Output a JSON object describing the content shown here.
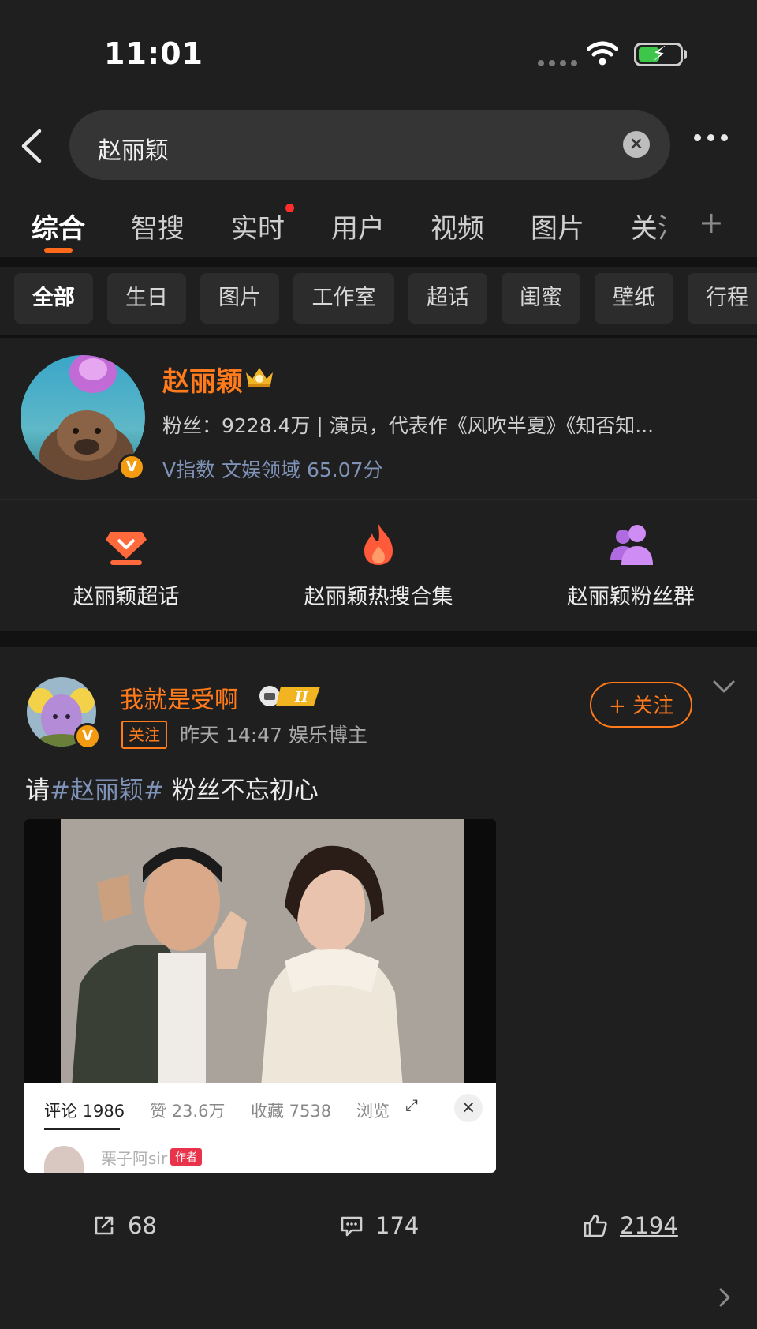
{
  "status_bar": {
    "time": "11:01"
  },
  "search": {
    "query": "赵丽颖"
  },
  "tabs": [
    {
      "label": "综合",
      "active": true
    },
    {
      "label": "智搜"
    },
    {
      "label": "实时",
      "has_dot": true
    },
    {
      "label": "用户"
    },
    {
      "label": "视频"
    },
    {
      "label": "图片"
    },
    {
      "label": "关注"
    }
  ],
  "chips": [
    "全部",
    "生日",
    "图片",
    "工作室",
    "超话",
    "闺蜜",
    "壁纸",
    "行程"
  ],
  "profile": {
    "name": "赵丽颖",
    "description": "粉丝：9228.4万 | 演员，代表作《风吹半夏》《知否知...",
    "v_index": "V指数 文娱领域 65.07分",
    "badge": "V"
  },
  "quick_links": [
    {
      "label": "赵丽颖超话",
      "icon": "supertopic-icon"
    },
    {
      "label": "赵丽颖热搜合集",
      "icon": "fire-icon"
    },
    {
      "label": "赵丽颖粉丝群",
      "icon": "fan-group-icon"
    }
  ],
  "post": {
    "author": "我就是受啊",
    "follow_tag": "关注",
    "meta": "昨天 14:47  娱乐博主",
    "follow_button": "+ 关注",
    "text_prefix": "请",
    "hashtag": "#赵丽颖#",
    "text_suffix": " 粉丝不忘初心",
    "media_panel": {
      "tabs": [
        "评论 1986",
        "赞 23.6万",
        "收藏 7538",
        "浏览"
      ],
      "commenter": "栗子阿sir",
      "author_tag": "作者"
    },
    "shares": "68",
    "comments": "174",
    "likes": "2194"
  },
  "colors": {
    "accent": "#ff7a1a",
    "background": "#1f1f1f",
    "link": "#7f93b8"
  }
}
